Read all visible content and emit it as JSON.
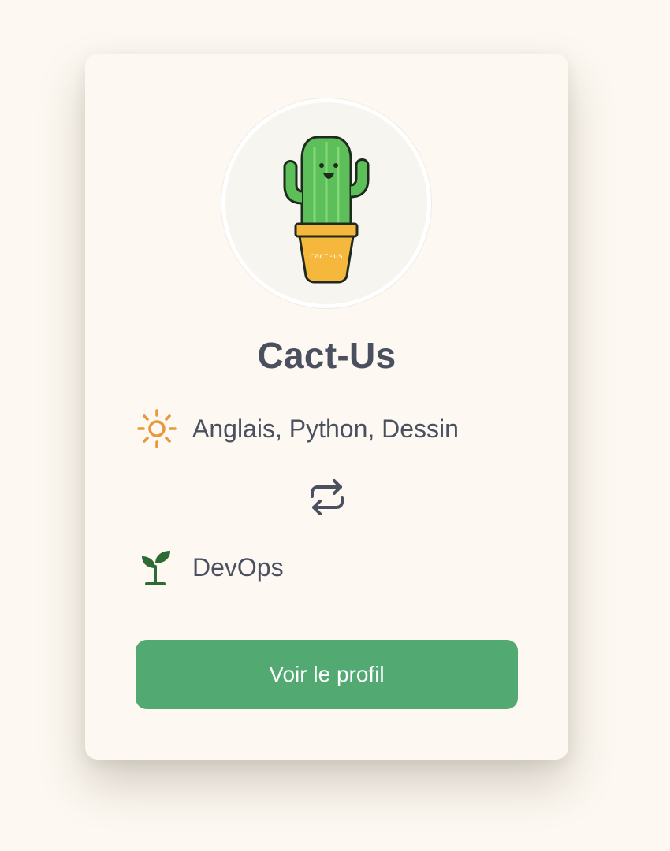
{
  "profile": {
    "avatar_text": "cact-us",
    "name": "Cact-Us"
  },
  "skills": {
    "teaches_icon": "sun-icon",
    "teaches": "Anglais, Python, Dessin",
    "exchange_icon": "swap-arrows-icon",
    "learns_icon": "sprout-icon",
    "learns": "DevOps"
  },
  "actions": {
    "view_profile_label": "Voir le profil"
  },
  "colors": {
    "background": "#fdf8f1",
    "text": "#4a5060",
    "accent_green": "#52a971",
    "sun_orange": "#e9973a",
    "sprout_green": "#2e6b34"
  }
}
